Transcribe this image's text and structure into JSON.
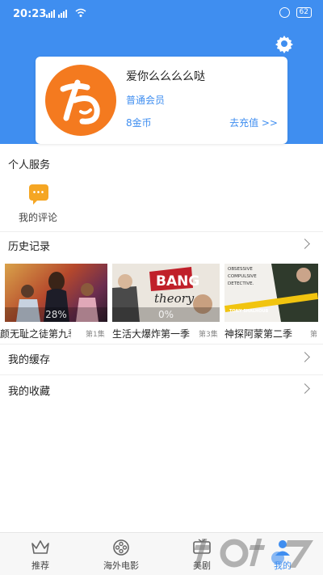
{
  "status_bar": {
    "time": "20:23",
    "battery": "62"
  },
  "profile": {
    "username": "爱你么么么么哒",
    "membership": "普通会员",
    "coins": "8金币",
    "recharge_label": "去充值 >>"
  },
  "personal_services": {
    "title": "个人服务",
    "items": [
      {
        "label": "我的评论",
        "icon": "comment-icon"
      }
    ]
  },
  "history": {
    "title": "历史记录",
    "items": [
      {
        "title": "厚颜无耻之徒第九季",
        "episode": "第1集",
        "progress": "28%"
      },
      {
        "title": "生活大爆炸第一季",
        "episode": "第3集",
        "progress": "0%"
      },
      {
        "title": "神探阿蒙第二季",
        "episode": "第",
        "progress": ""
      }
    ],
    "poster_texts": {
      "big_bang": "BANG",
      "theory": "theory",
      "monk_lines": [
        "OBSESSIVE",
        "COMPULSIVE",
        "DETECTIVE."
      ],
      "monk_actor": "TONY SHALHOUB"
    }
  },
  "cache": {
    "title": "我的缓存"
  },
  "favorites": {
    "title": "我的收藏"
  },
  "bottom_nav": {
    "items": [
      {
        "label": "推荐",
        "icon": "crown-icon"
      },
      {
        "label": "海外电影",
        "icon": "film-reel-icon"
      },
      {
        "label": "美剧",
        "icon": "tv-icon"
      },
      {
        "label": "我的",
        "icon": "user-icon"
      }
    ]
  },
  "colors": {
    "accent": "#3f8ef0",
    "avatar": "#f47a1f",
    "comment_icon": "#f5a623"
  }
}
